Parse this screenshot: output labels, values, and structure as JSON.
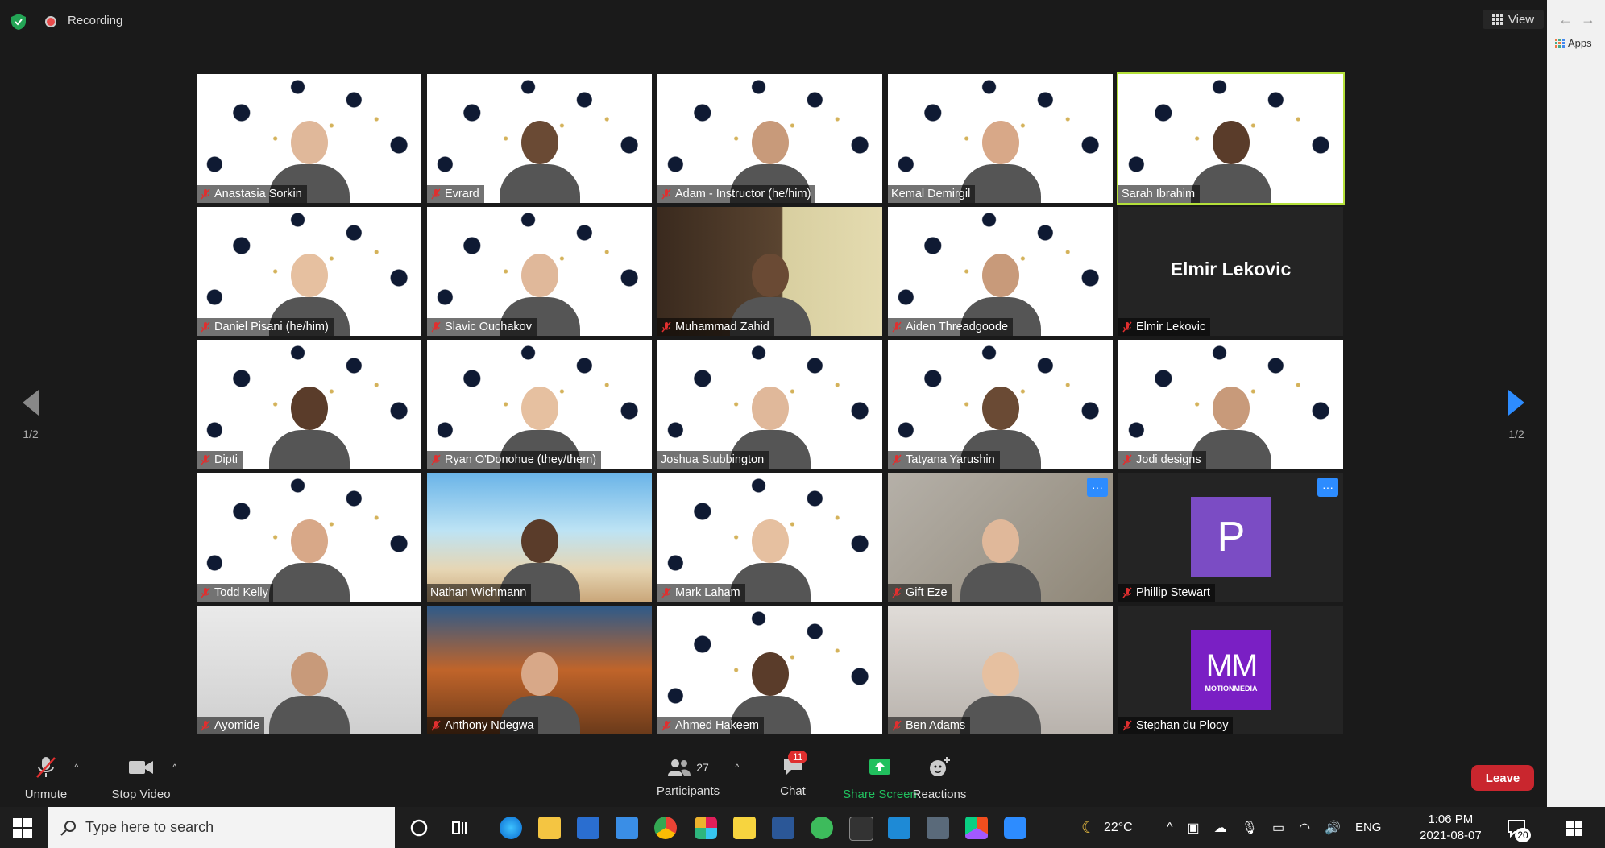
{
  "topbar": {
    "recording_label": "Recording",
    "view_label": "View"
  },
  "participants": [
    {
      "name": "Anastasia Sorkin",
      "muted": true,
      "bg": "grad"
    },
    {
      "name": "Evrard",
      "muted": true,
      "bg": "grad"
    },
    {
      "name": "Adam - Instructor (he/him)",
      "muted": true,
      "bg": "grad"
    },
    {
      "name": "Kemal Demirgil",
      "muted": false,
      "bg": "grad"
    },
    {
      "name": "Sarah Ibrahim",
      "muted": false,
      "bg": "grad",
      "active": true
    },
    {
      "name": "Daniel Pisani (he/him)",
      "muted": true,
      "bg": "grad"
    },
    {
      "name": "Slavic Ouchakov",
      "muted": true,
      "bg": "grad"
    },
    {
      "name": "Muhammad Zahid",
      "muted": true,
      "bg": "room"
    },
    {
      "name": "Aiden Threadgoode",
      "muted": true,
      "bg": "grad"
    },
    {
      "name": "Elmir Lekovic",
      "muted": true,
      "bg": "dark",
      "display_name": "Elmir Lekovic"
    },
    {
      "name": "Dipti",
      "muted": true,
      "bg": "grad"
    },
    {
      "name": "Ryan O'Donohue (they/them)",
      "muted": true,
      "bg": "grad"
    },
    {
      "name": "Joshua Stubbington",
      "muted": false,
      "bg": "grad"
    },
    {
      "name": "Tatyana Yarushin",
      "muted": true,
      "bg": "grad"
    },
    {
      "name": "Jodi designs",
      "muted": true,
      "bg": "grad"
    },
    {
      "name": "Todd Kelly",
      "muted": true,
      "bg": "grad"
    },
    {
      "name": "Nathan Wichmann",
      "muted": false,
      "bg": "beach"
    },
    {
      "name": "Mark Laham",
      "muted": true,
      "bg": "grad"
    },
    {
      "name": "Gift Eze",
      "muted": true,
      "bg": "blurred",
      "more": "···"
    },
    {
      "name": "Phillip Stewart",
      "muted": true,
      "bg": "dark",
      "avatar_letter": "P",
      "more": "···"
    },
    {
      "name": "Ayomide",
      "muted": true,
      "bg": "home"
    },
    {
      "name": "Anthony Ndegwa",
      "muted": true,
      "bg": "mountain"
    },
    {
      "name": "Ahmed Hakeem",
      "muted": true,
      "bg": "grad"
    },
    {
      "name": "Ben Adams",
      "muted": true,
      "bg": "ben"
    },
    {
      "name": "Stephan du Plooy",
      "muted": true,
      "bg": "dark",
      "logo_text": "MM",
      "logo_sub": "MOTIONMEDIA"
    }
  ],
  "pager": {
    "left": "1/2",
    "right": "1/2"
  },
  "toolbar": {
    "unmute": "Unmute",
    "stop_video": "Stop Video",
    "participants_label": "Participants",
    "participants_count": "27",
    "chat_label": "Chat",
    "chat_badge": "11",
    "share_label": "Share Screen",
    "reactions_label": "Reactions",
    "leave": "Leave"
  },
  "browser": {
    "apps_label": "Apps"
  },
  "taskbar": {
    "search_placeholder": "Type here to search",
    "weather": "22°C",
    "lang": "ENG",
    "time": "1:06 PM",
    "date": "2021-08-07",
    "notif_count": "20"
  },
  "colors": {
    "active_speaker": "#b4e03a",
    "leave": "#c9262e",
    "share": "#21c05e",
    "accent": "#2d8cff",
    "taskbar": "#1e1e1e"
  }
}
